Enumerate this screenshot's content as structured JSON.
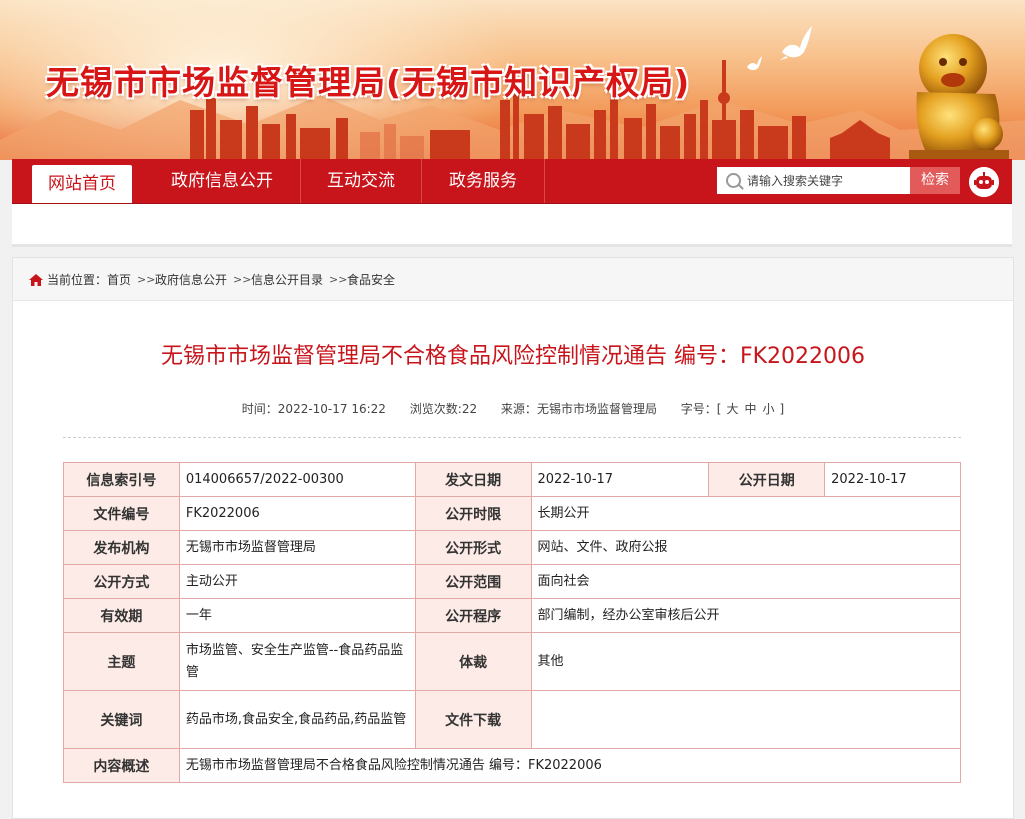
{
  "site": {
    "title": "无锡市市场监督管理局(无锡市知识产权局)"
  },
  "nav": {
    "items": [
      {
        "label": "网站首页",
        "active": true
      },
      {
        "label": "政府信息公开",
        "active": false
      },
      {
        "label": "互动交流",
        "active": false
      },
      {
        "label": "政务服务",
        "active": false
      }
    ],
    "search_placeholder": "请输入搜索关键字",
    "search_button": "检索",
    "assistant_icon": "robot-icon"
  },
  "breadcrumb": {
    "prefix": "当前位置：",
    "items": [
      "首页",
      "政府信息公开",
      "信息公开目录",
      "食品安全"
    ],
    "separator": ">>"
  },
  "article": {
    "title": "无锡市市场监督管理局不合格食品风险控制情况通告 编号：FK2022006",
    "time_label": "时间：",
    "time": "2022-10-17 16:22",
    "views_label": "浏览次数:",
    "views": "22",
    "source_label": "来源：",
    "source": "无锡市市场监督管理局",
    "font_size_label": "字号：",
    "font_sizes": [
      "大",
      "中",
      "小"
    ],
    "bracket_open": "[",
    "bracket_close": "]"
  },
  "info_table": {
    "index_no_label": "信息索引号",
    "index_no": "014006657/2022-00300",
    "issue_date_label": "发文日期",
    "issue_date": "2022-10-17",
    "publish_date_label": "公开日期",
    "publish_date": "2022-10-17",
    "doc_no_label": "文件编号",
    "doc_no": "FK2022006",
    "time_limit_label": "公开时限",
    "time_limit": "长期公开",
    "org_label": "发布机构",
    "org": "无锡市市场监督管理局",
    "form_label": "公开形式",
    "form": "网站、文件、政府公报",
    "method_label": "公开方式",
    "method": "主动公开",
    "scope_label": "公开范围",
    "scope": "面向社会",
    "validity_label": "有效期",
    "validity": "一年",
    "procedure_label": "公开程序",
    "procedure": "部门编制，经办公室审核后公开",
    "topic_label": "主题",
    "topic": "市场监管、安全生产监管--食品药品监管",
    "genre_label": "体裁",
    "genre": "其他",
    "keywords_label": "关键词",
    "keywords": "药品市场,食品安全,食品药品,药品监管",
    "download_label": "文件下载",
    "download": "",
    "summary_label": "内容概述",
    "summary": "无锡市市场监督管理局不合格食品风险控制情况通告 编号：FK2022006"
  },
  "colors": {
    "brand_red": "#c8151b",
    "title_red": "#d81616",
    "table_border": "#e3a9a9",
    "label_bg": "#fcebe6"
  }
}
